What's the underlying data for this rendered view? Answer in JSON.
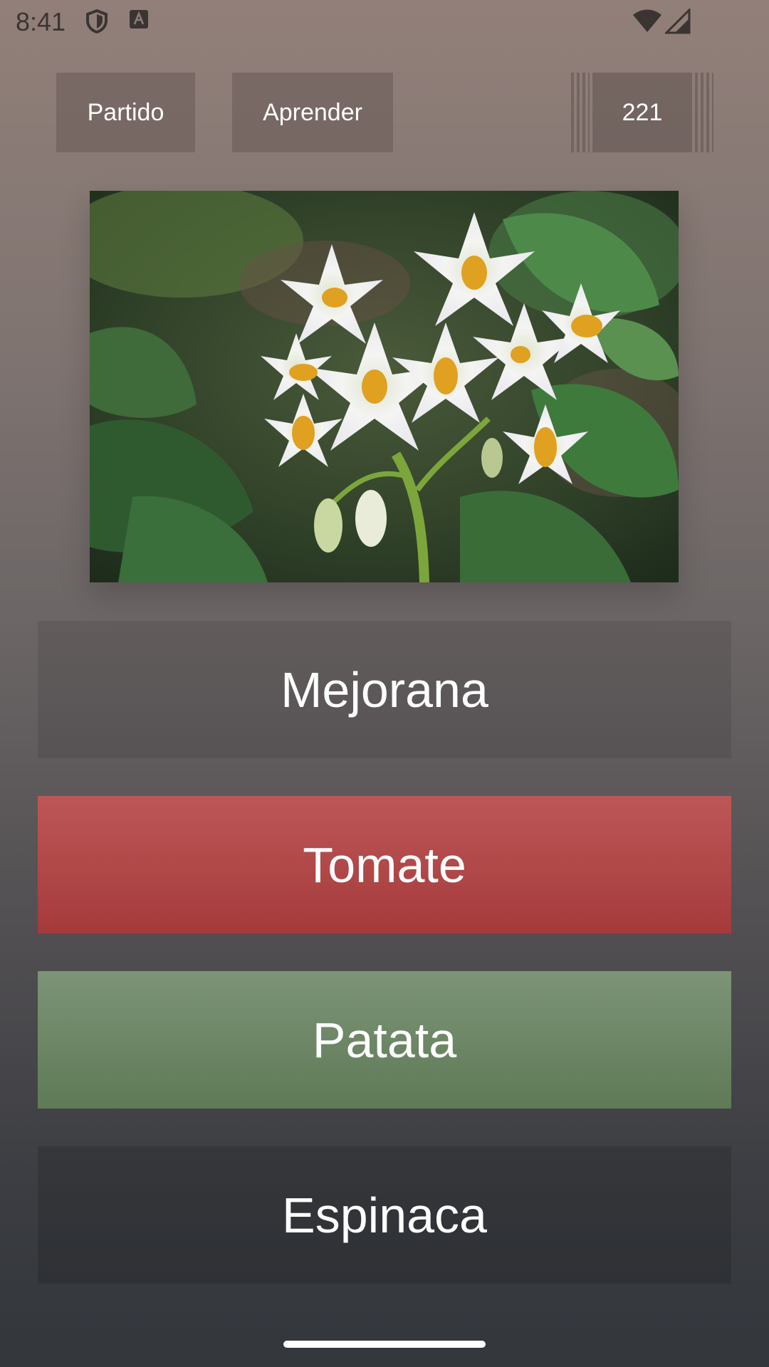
{
  "status_bar": {
    "time": "8:41",
    "icons": [
      "shield-icon",
      "font-a-icon",
      "wifi-icon",
      "cell-signal-icon"
    ]
  },
  "top_bar": {
    "match_label": "Partido",
    "learn_label": "Aprender",
    "score": "221"
  },
  "quiz": {
    "image_subject": "white-potato-flowers-photo",
    "answers": [
      {
        "label": "Mejorana",
        "state": "neutral"
      },
      {
        "label": "Tomate",
        "state": "wrong"
      },
      {
        "label": "Patata",
        "state": "correct"
      },
      {
        "label": "Espinaca",
        "state": "neutral"
      }
    ]
  },
  "colors": {
    "wrong": "#b04546",
    "correct": "#6e8866",
    "neutral": "#5a5454"
  }
}
